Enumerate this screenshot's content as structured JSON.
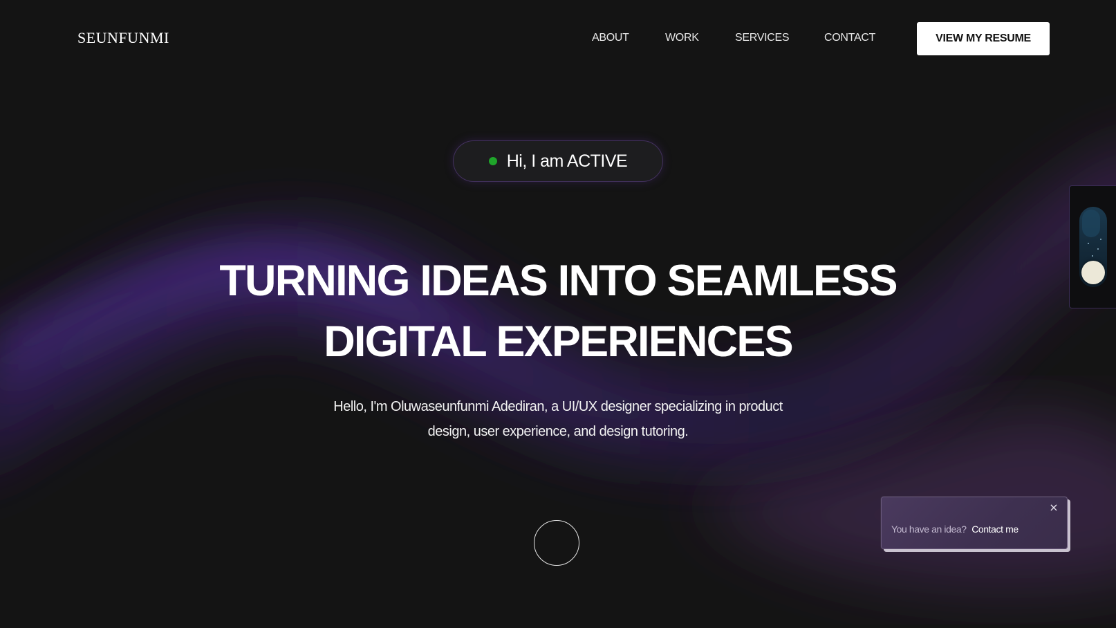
{
  "nav": {
    "logo": "SEUNFUNMI",
    "links": [
      {
        "label": "ABOUT"
      },
      {
        "label": "WORK"
      },
      {
        "label": "SERVICES"
      },
      {
        "label": "CONTACT"
      }
    ],
    "resume_button": "VIEW MY RESUME"
  },
  "status": {
    "text": "Hi, I am ACTIVE",
    "dot_color": "#1fa52a"
  },
  "hero": {
    "headline_line1": "TURNING IDEAS INTO SEAMLESS",
    "headline_line2": "DIGITAL EXPERIENCES",
    "intro_line1": "Hello, I'm Oluwaseunfunmi Adediran, a UI/UX designer specializing in product",
    "intro_line2": "design, user experience, and design tutoring."
  },
  "theme_toggle": {
    "mode": "dark",
    "icon": "moon-icon"
  },
  "toast": {
    "prompt": "You have an idea?",
    "link": "Contact me",
    "close_icon": "close-icon",
    "close_glyph": "×"
  },
  "colors": {
    "background": "#141414",
    "accent_purple": "#5a2fa0",
    "button_bg": "#ffffff",
    "status_green": "#1fa52a"
  }
}
